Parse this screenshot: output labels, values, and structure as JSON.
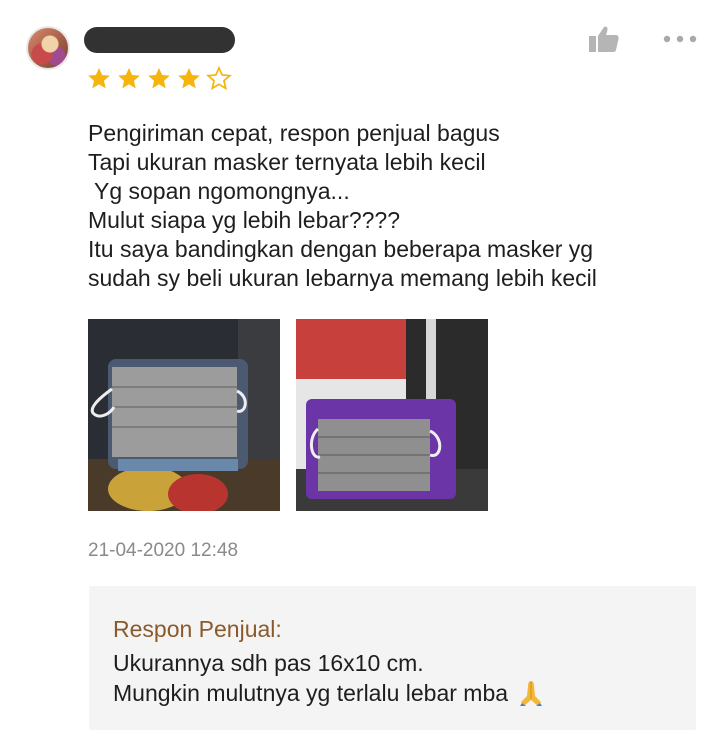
{
  "review": {
    "rating": 4,
    "max_rating": 5,
    "text_lines": [
      "Pengiriman cepat, respon penjual bagus",
      "Tapi ukuran masker ternyata lebih kecil",
      " Yg sopan ngomongnya...",
      "Mulut siapa yg lebih lebar????",
      "Itu saya bandingkan dengan beberapa masker yg",
      "sudah sy beli ukuran lebarnya memang lebih kecil"
    ],
    "timestamp": "21-04-2020 12:48"
  },
  "icons": {
    "like": "thumbs-up-icon",
    "more": "more-dots-icon",
    "star_filled": "star-filled-icon",
    "star_empty": "star-outline-icon",
    "pray": "folded-hands-icon"
  },
  "colors": {
    "star": "#f6b50e",
    "seller_title": "#8a5a2b",
    "timestamp": "#8a8a8a",
    "seller_bg": "#f4f4f4",
    "icon_gray": "#b5b5b5"
  },
  "seller_response": {
    "title": "Respon Penjual:",
    "lines": [
      "Ukurannya sdh pas 16x10 cm.",
      "Mungkin mulutnya yg terlalu lebar mba"
    ]
  }
}
